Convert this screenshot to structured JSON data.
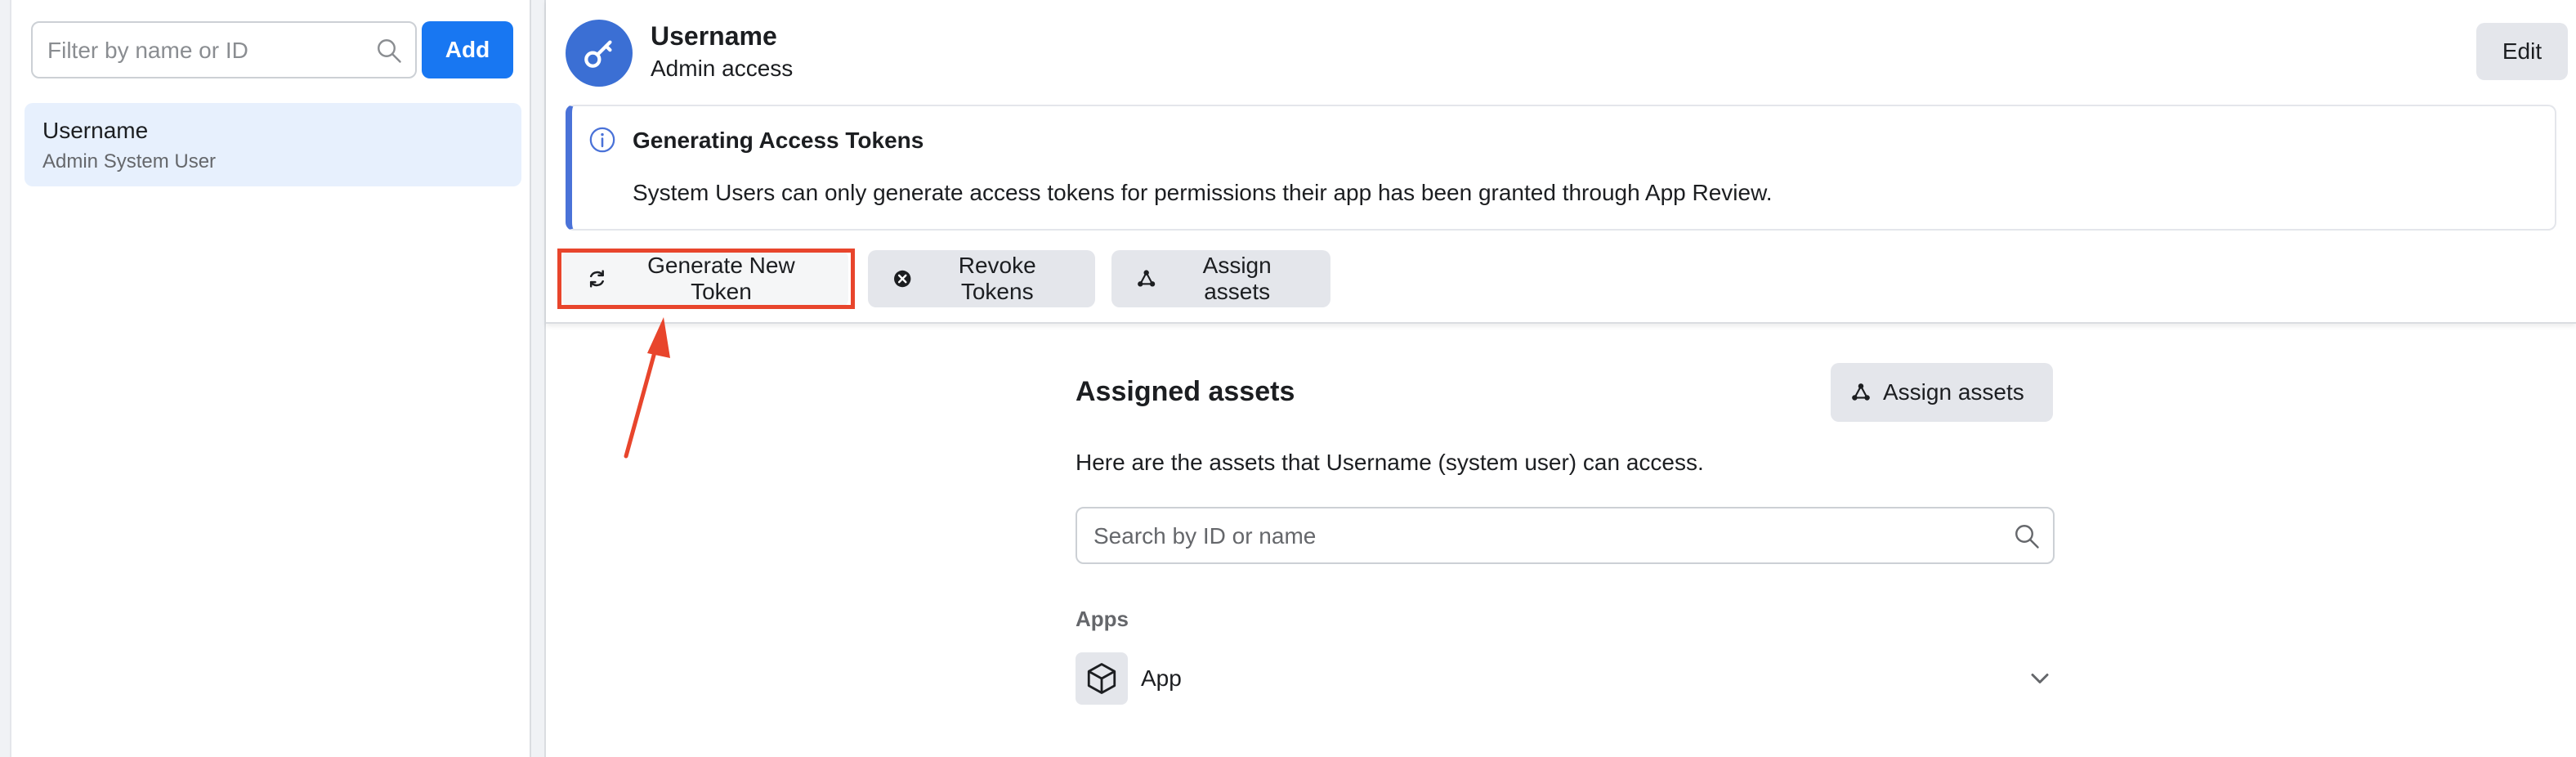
{
  "sidebar": {
    "filter_placeholder": "Filter by name or ID",
    "add_label": "Add",
    "users": [
      {
        "name": "Username",
        "role": "Admin System User"
      }
    ]
  },
  "header": {
    "title": "Username",
    "subtitle": "Admin access",
    "edit_label": "Edit"
  },
  "notice": {
    "title": "Generating Access Tokens",
    "body": "System Users can only generate access tokens for permissions their app has been granted through App Review."
  },
  "actions": {
    "generate_label": "Generate New Token",
    "revoke_label": "Revoke Tokens",
    "assign_label": "Assign assets"
  },
  "assets": {
    "title": "Assigned assets",
    "assign_label": "Assign assets",
    "description": "Here are the assets that Username (system user) can access.",
    "search_placeholder": "Search by ID or name",
    "group_label": "Apps",
    "items": [
      {
        "name": "App"
      }
    ]
  },
  "colors": {
    "primary": "#1877f2",
    "highlight": "#e8452c",
    "selected_bg": "#e7f0fd",
    "avatar": "#3b6fd4"
  }
}
